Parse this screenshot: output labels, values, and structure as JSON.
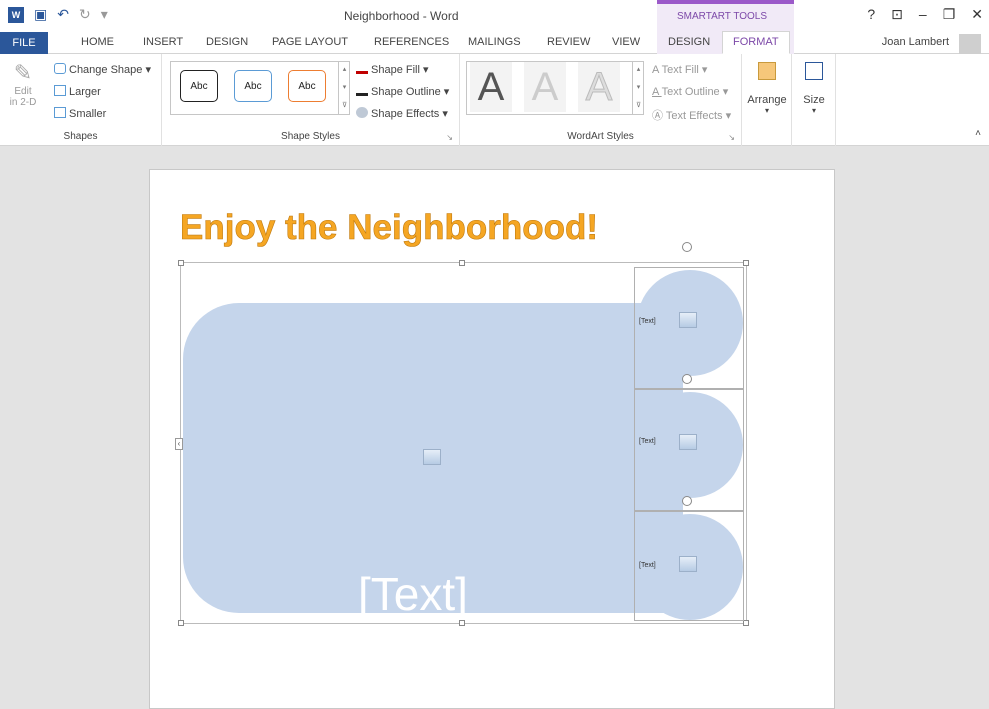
{
  "window": {
    "title": "Neighborhood - Word",
    "context_group": "SMARTART TOOLS",
    "user": "Joan Lambert"
  },
  "tabs": [
    {
      "label": "FILE"
    },
    {
      "label": "HOME"
    },
    {
      "label": "INSERT"
    },
    {
      "label": "DESIGN"
    },
    {
      "label": "PAGE LAYOUT"
    },
    {
      "label": "REFERENCES"
    },
    {
      "label": "MAILINGS"
    },
    {
      "label": "REVIEW"
    },
    {
      "label": "VIEW"
    },
    {
      "label": "DESIGN"
    },
    {
      "label": "FORMAT"
    }
  ],
  "ribbon": {
    "shapes": {
      "edit_2d_line1": "Edit",
      "edit_2d_line2": "in 2-D",
      "change_shape": "Change Shape",
      "larger": "Larger",
      "smaller": "Smaller",
      "label": "Shapes"
    },
    "shape_styles": {
      "style_label": "Abc",
      "shape_fill": "Shape Fill",
      "shape_outline": "Shape Outline",
      "shape_effects": "Shape Effects",
      "label": "Shape Styles"
    },
    "wordart_styles": {
      "letter": "A",
      "text_fill": "Text Fill",
      "text_outline": "Text Outline",
      "text_effects": "Text Effects",
      "label": "WordArt Styles"
    },
    "arrange": "Arrange",
    "size": "Size"
  },
  "document": {
    "heading": "Enjoy the Neighborhood!",
    "big_placeholder": "[Text]",
    "small_placeholder": "[Text]"
  },
  "colors": {
    "accent": "#2b579a",
    "context": "#7c48a8",
    "heading": "#f5a623",
    "shape_fill": "#c5d5eb"
  }
}
